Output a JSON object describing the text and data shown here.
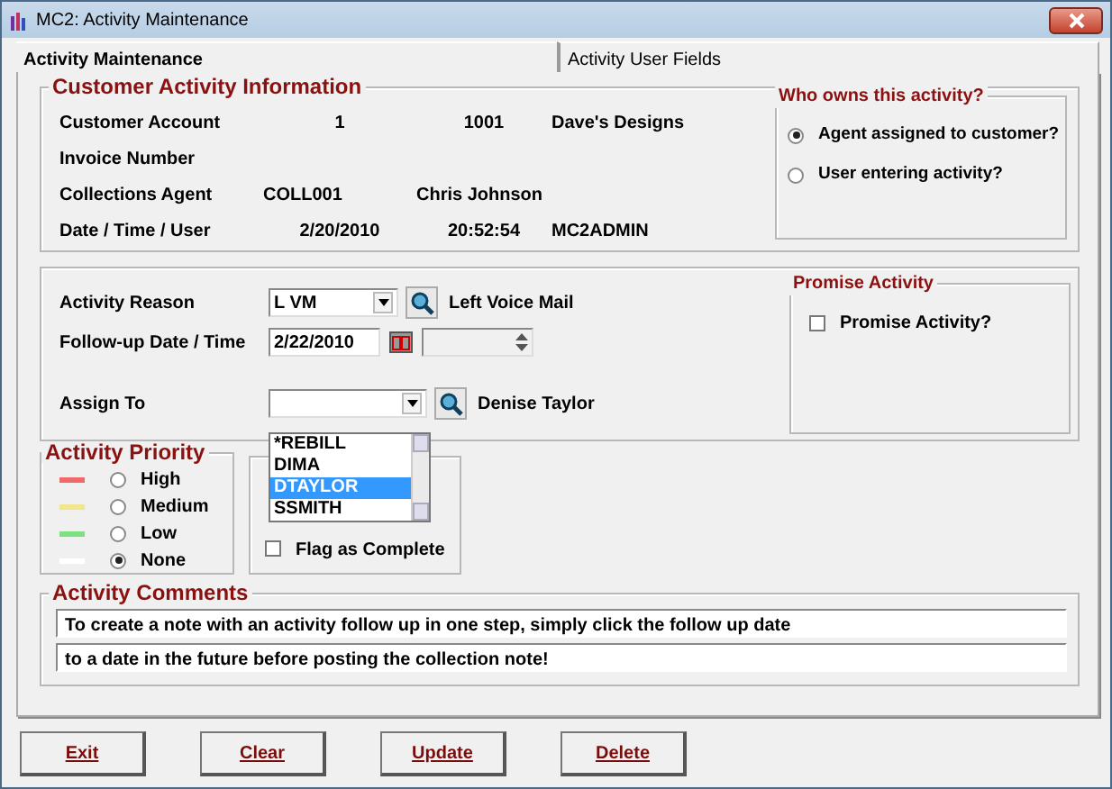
{
  "window": {
    "title": "MC2: Activity Maintenance"
  },
  "tabs": [
    {
      "label": "Activity Maintenance",
      "selected": true
    },
    {
      "label": "Activity User Fields",
      "selected": false
    }
  ],
  "customer_info": {
    "title": "Customer Activity Information",
    "rows": [
      {
        "label": "Customer Account",
        "values": [
          "1",
          "1001",
          "Dave's Designs"
        ]
      },
      {
        "label": "Invoice Number",
        "values": []
      },
      {
        "label": "Collections Agent",
        "values": [
          "COLL001",
          "Chris Johnson"
        ]
      },
      {
        "label": "Date / Time / User",
        "values": [
          "2/20/2010",
          "20:52:54",
          "MC2ADMIN"
        ]
      }
    ]
  },
  "owner": {
    "title": "Who owns this activity?",
    "options": [
      {
        "label": "Agent assigned to customer?",
        "selected": true
      },
      {
        "label": "User entering activity?",
        "selected": false
      }
    ]
  },
  "activity_reason": {
    "label": "Activity Reason",
    "value": "L VM",
    "description": "Left Voice Mail"
  },
  "follow_up": {
    "label": "Follow-up Date / Time",
    "date": "2/22/2010",
    "time_disabled": true
  },
  "assign_to": {
    "label": "Assign To",
    "description": "Denise Taylor",
    "expanded": true,
    "options": [
      {
        "label": "*REBILL",
        "selected": false
      },
      {
        "label": "DIMA",
        "selected": false
      },
      {
        "label": "DTAYLOR",
        "selected": true
      },
      {
        "label": "SSMITH",
        "selected": false
      }
    ]
  },
  "promise": {
    "title": "Promise Activity",
    "label": "Promise Activity?",
    "checked": false
  },
  "priority": {
    "title": "Activity Priority",
    "options": [
      {
        "label": "High",
        "color": "#f06868",
        "selected": false
      },
      {
        "label": "Medium",
        "color": "#f0e68c",
        "selected": false
      },
      {
        "label": "Low",
        "color": "#7ee07e",
        "selected": false
      },
      {
        "label": "None",
        "color": "#ffffff",
        "selected": true
      }
    ]
  },
  "complete": {
    "label": "Flag as Complete",
    "checked": false
  },
  "comments": {
    "title": "Activity Comments",
    "lines": [
      "To create a note with an activity follow up in one step, simply click the follow up date",
      "to a date in the future before posting the collection note!"
    ]
  },
  "buttons": [
    {
      "label": "Exit"
    },
    {
      "label": "Clear"
    },
    {
      "label": "Update"
    },
    {
      "label": "Delete"
    }
  ]
}
